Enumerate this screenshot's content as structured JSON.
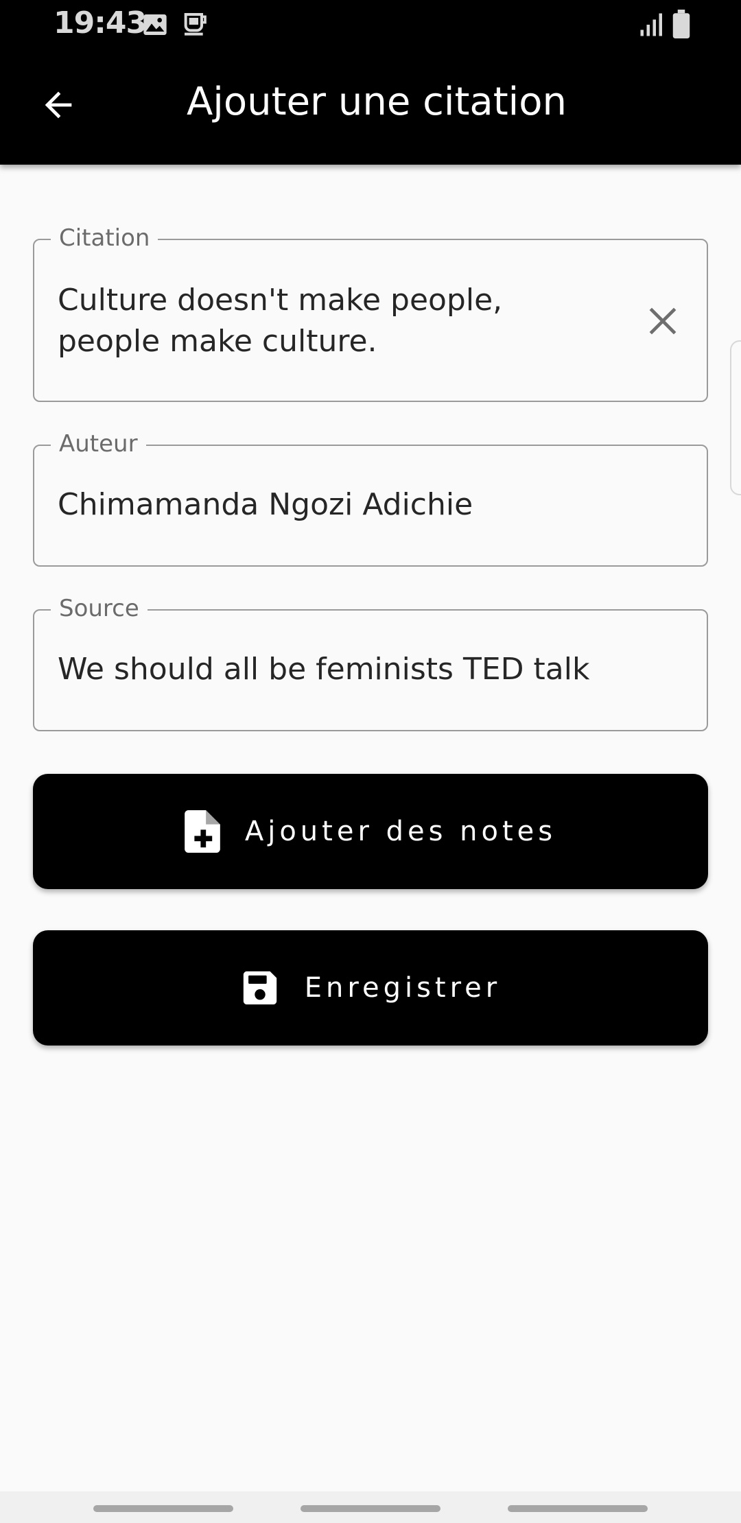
{
  "status_bar": {
    "time": "19:43",
    "icons": [
      "image-icon",
      "coffee-icon",
      "signal-icon",
      "battery-icon"
    ]
  },
  "app_bar": {
    "title": "Ajouter une citation",
    "back_icon": "arrow-left-icon"
  },
  "form": {
    "citation": {
      "label": "Citation",
      "value_line1": "Culture doesn't make people,",
      "value_line2": "people make culture.",
      "clear_icon": "close-icon"
    },
    "author": {
      "label": "Auteur",
      "value": "Chimamanda Ngozi Adichie"
    },
    "source": {
      "label": "Source",
      "value": "We should all be feminists TED talk"
    }
  },
  "buttons": {
    "add_notes": {
      "label": "Ajouter des notes",
      "icon": "file-plus-icon"
    },
    "save": {
      "label": "Enregistrer",
      "icon": "floppy-disk-icon"
    }
  },
  "colors": {
    "bar_background": "#000000",
    "page_background": "#fafafa",
    "button_background": "#000000",
    "button_text": "#ffffff",
    "field_border": "#9a9a9a"
  }
}
